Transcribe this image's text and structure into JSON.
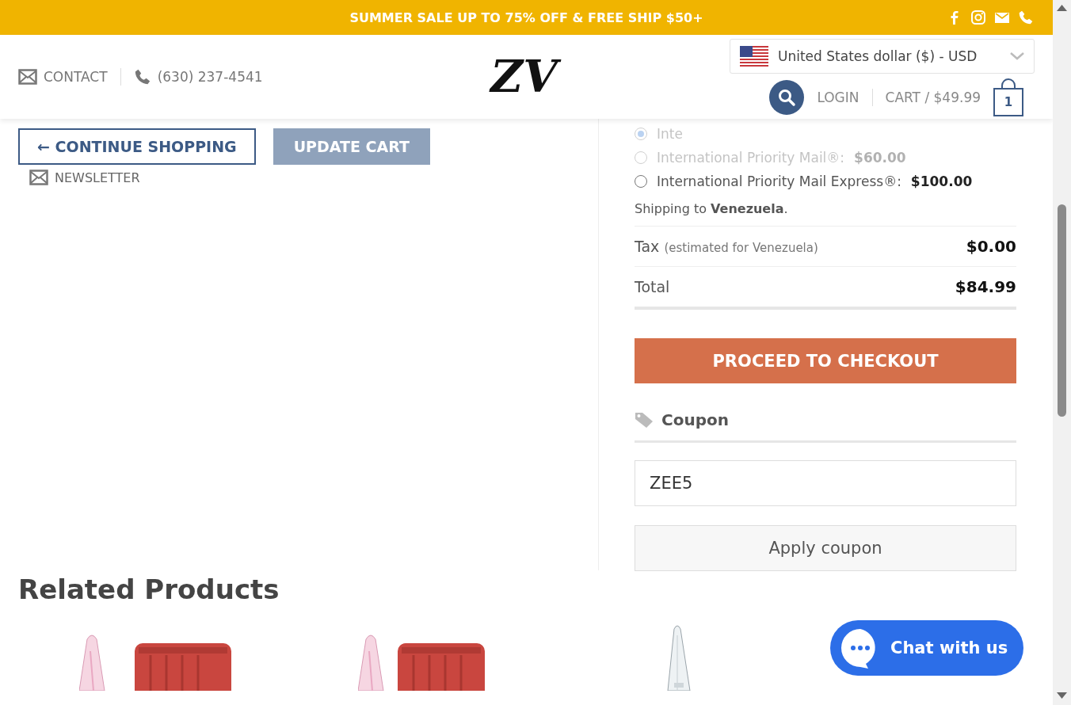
{
  "promo_bar": {
    "text": "SUMMER SALE UP TO 75% OFF & FREE SHIP $50+"
  },
  "header": {
    "contact": "CONTACT",
    "phone": "(630) 237-4541",
    "logo": "ZV",
    "currency": "United States dollar ($) - USD",
    "login": "LOGIN",
    "cart": "CART / $49.99",
    "cart_count": "1"
  },
  "cart_actions": {
    "continue": "← CONTINUE SHOPPING",
    "update": "UPDATE CART",
    "newsletter": "NEWSLETTER"
  },
  "shipping": {
    "options": [
      {
        "label": "Inte",
        "selected": true,
        "dimmed": true
      },
      {
        "label": "International Priority Mail®:",
        "price": "$60.00",
        "selected": false,
        "dimmed": true
      },
      {
        "label": "International Priority Mail Express®:",
        "price": "$100.00",
        "selected": false,
        "dimmed": false
      }
    ],
    "destination_prefix": "Shipping to",
    "destination": "Venezuela",
    "destination_suffix": "."
  },
  "totals": [
    {
      "label": "Tax",
      "note": "(estimated for Venezuela)",
      "value": "$0.00"
    },
    {
      "label": "Total",
      "value": "$84.99"
    }
  ],
  "checkout_button": "PROCEED TO CHECKOUT",
  "coupon": {
    "title": "Coupon",
    "value": "ZEE5",
    "button": "Apply coupon"
  },
  "related": {
    "title": "Related Products"
  },
  "chat": {
    "label": "Chat with us"
  }
}
